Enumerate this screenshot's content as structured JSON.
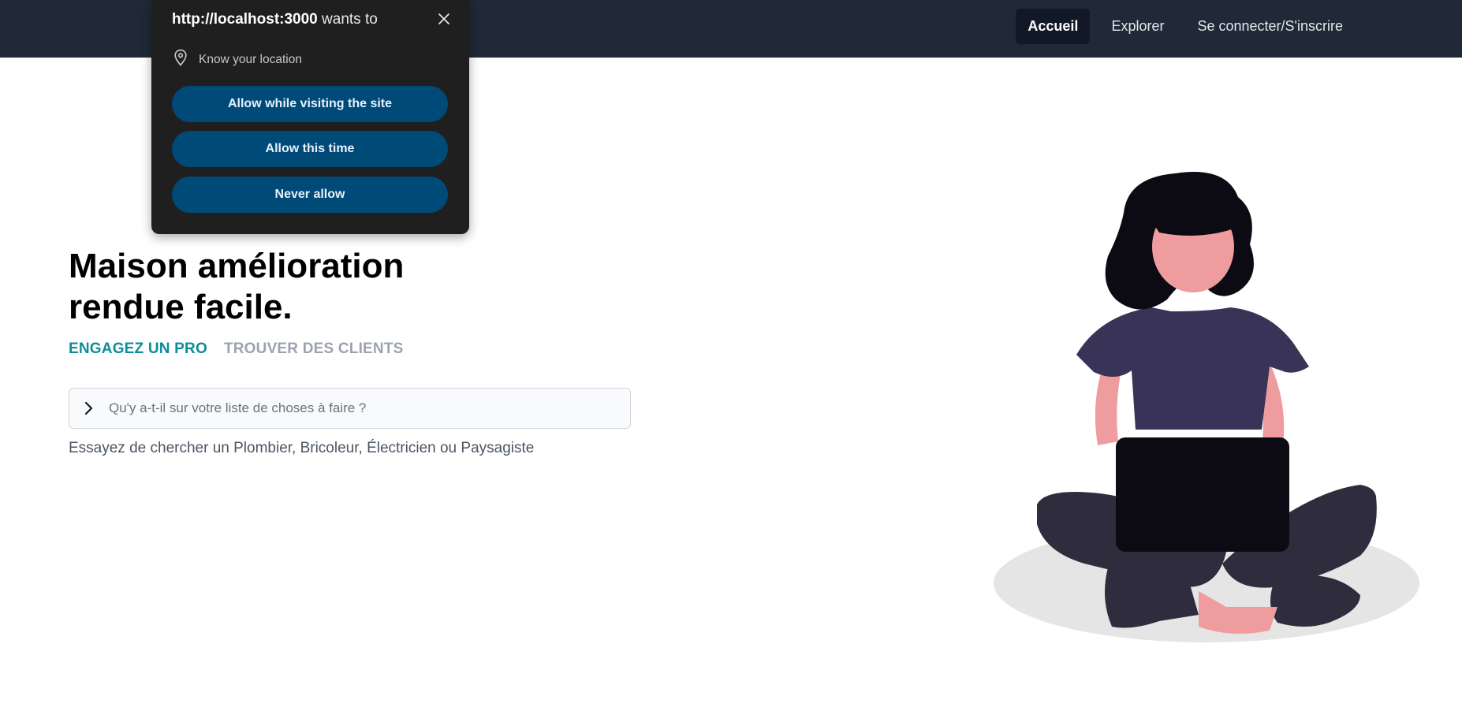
{
  "nav": {
    "items": [
      {
        "label": "Accueil",
        "active": true
      },
      {
        "label": "Explorer",
        "active": false
      },
      {
        "label": "Se connecter/S'inscrire",
        "active": false
      }
    ]
  },
  "hero": {
    "title_line1": "Maison amélioration",
    "title_line2": "rendue facile.",
    "tabs": [
      {
        "label": "ENGAGEZ UN PRO",
        "active": true
      },
      {
        "label": "TROUVER DES CLIENTS",
        "active": false
      }
    ],
    "search": {
      "placeholder": "Qu'y a-t-il sur votre liste de choses à faire ?",
      "value": ""
    },
    "suggestion": "Essayez de chercher un Plombier, Bricoleur, Électricien ou Paysagiste"
  },
  "permission_popup": {
    "origin": "http://localhost:3000",
    "wants_to": "wants to",
    "permission": "Know your location",
    "buttons": {
      "allow_site": "Allow while visiting the site",
      "allow_once": "Allow this time",
      "never": "Never allow"
    }
  },
  "colors": {
    "navbar": "#1f2937",
    "accent": "#0e8c9b",
    "popup_bg": "#1f1f1f",
    "popup_button": "#004a77",
    "shirt": "#3a3358",
    "skin": "#ee9c9e",
    "hair": "#0c0b14"
  },
  "icons": {
    "close": "close-icon",
    "location": "location-pin-icon",
    "chevron": "chevron-right-icon"
  }
}
